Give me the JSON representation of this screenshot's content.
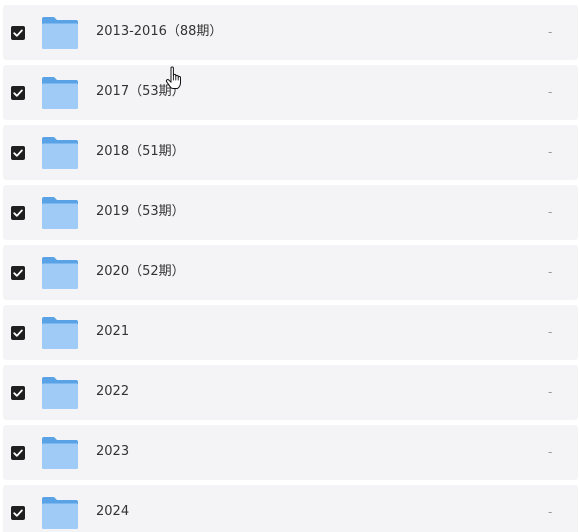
{
  "colors": {
    "row_background": "#f4f4f6",
    "checkbox": "#1f1f1f",
    "folder_back": "#5aa2e6",
    "folder_front": "#9fcbf6",
    "text": "#333333",
    "meta_text": "#9a9a9a"
  },
  "icons": {
    "checkbox": "checkbox-checked-icon",
    "folder": "folder-icon",
    "cursor": "hand-pointer-cursor-icon"
  },
  "folders": [
    {
      "name": "2013-2016（88期）",
      "size": "-",
      "checked": true
    },
    {
      "name": "2017（53期）",
      "size": "-",
      "checked": true
    },
    {
      "name": "2018（51期）",
      "size": "-",
      "checked": true
    },
    {
      "name": "2019（53期）",
      "size": "-",
      "checked": true
    },
    {
      "name": "2020（52期）",
      "size": "-",
      "checked": true
    },
    {
      "name": "2021",
      "size": "-",
      "checked": true
    },
    {
      "name": "2022",
      "size": "-",
      "checked": true
    },
    {
      "name": "2023",
      "size": "-",
      "checked": true
    },
    {
      "name": "2024",
      "size": "-",
      "checked": true
    }
  ]
}
